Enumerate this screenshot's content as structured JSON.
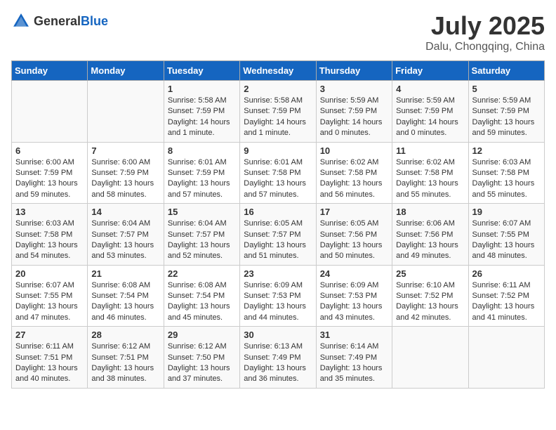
{
  "header": {
    "logo_general": "General",
    "logo_blue": "Blue",
    "month": "July 2025",
    "location": "Dalu, Chongqing, China"
  },
  "weekdays": [
    "Sunday",
    "Monday",
    "Tuesday",
    "Wednesday",
    "Thursday",
    "Friday",
    "Saturday"
  ],
  "weeks": [
    [
      {
        "day": "",
        "detail": ""
      },
      {
        "day": "",
        "detail": ""
      },
      {
        "day": "1",
        "detail": "Sunrise: 5:58 AM\nSunset: 7:59 PM\nDaylight: 14 hours\nand 1 minute."
      },
      {
        "day": "2",
        "detail": "Sunrise: 5:58 AM\nSunset: 7:59 PM\nDaylight: 14 hours\nand 1 minute."
      },
      {
        "day": "3",
        "detail": "Sunrise: 5:59 AM\nSunset: 7:59 PM\nDaylight: 14 hours\nand 0 minutes."
      },
      {
        "day": "4",
        "detail": "Sunrise: 5:59 AM\nSunset: 7:59 PM\nDaylight: 14 hours\nand 0 minutes."
      },
      {
        "day": "5",
        "detail": "Sunrise: 5:59 AM\nSunset: 7:59 PM\nDaylight: 13 hours\nand 59 minutes."
      }
    ],
    [
      {
        "day": "6",
        "detail": "Sunrise: 6:00 AM\nSunset: 7:59 PM\nDaylight: 13 hours\nand 59 minutes."
      },
      {
        "day": "7",
        "detail": "Sunrise: 6:00 AM\nSunset: 7:59 PM\nDaylight: 13 hours\nand 58 minutes."
      },
      {
        "day": "8",
        "detail": "Sunrise: 6:01 AM\nSunset: 7:59 PM\nDaylight: 13 hours\nand 57 minutes."
      },
      {
        "day": "9",
        "detail": "Sunrise: 6:01 AM\nSunset: 7:58 PM\nDaylight: 13 hours\nand 57 minutes."
      },
      {
        "day": "10",
        "detail": "Sunrise: 6:02 AM\nSunset: 7:58 PM\nDaylight: 13 hours\nand 56 minutes."
      },
      {
        "day": "11",
        "detail": "Sunrise: 6:02 AM\nSunset: 7:58 PM\nDaylight: 13 hours\nand 55 minutes."
      },
      {
        "day": "12",
        "detail": "Sunrise: 6:03 AM\nSunset: 7:58 PM\nDaylight: 13 hours\nand 55 minutes."
      }
    ],
    [
      {
        "day": "13",
        "detail": "Sunrise: 6:03 AM\nSunset: 7:58 PM\nDaylight: 13 hours\nand 54 minutes."
      },
      {
        "day": "14",
        "detail": "Sunrise: 6:04 AM\nSunset: 7:57 PM\nDaylight: 13 hours\nand 53 minutes."
      },
      {
        "day": "15",
        "detail": "Sunrise: 6:04 AM\nSunset: 7:57 PM\nDaylight: 13 hours\nand 52 minutes."
      },
      {
        "day": "16",
        "detail": "Sunrise: 6:05 AM\nSunset: 7:57 PM\nDaylight: 13 hours\nand 51 minutes."
      },
      {
        "day": "17",
        "detail": "Sunrise: 6:05 AM\nSunset: 7:56 PM\nDaylight: 13 hours\nand 50 minutes."
      },
      {
        "day": "18",
        "detail": "Sunrise: 6:06 AM\nSunset: 7:56 PM\nDaylight: 13 hours\nand 49 minutes."
      },
      {
        "day": "19",
        "detail": "Sunrise: 6:07 AM\nSunset: 7:55 PM\nDaylight: 13 hours\nand 48 minutes."
      }
    ],
    [
      {
        "day": "20",
        "detail": "Sunrise: 6:07 AM\nSunset: 7:55 PM\nDaylight: 13 hours\nand 47 minutes."
      },
      {
        "day": "21",
        "detail": "Sunrise: 6:08 AM\nSunset: 7:54 PM\nDaylight: 13 hours\nand 46 minutes."
      },
      {
        "day": "22",
        "detail": "Sunrise: 6:08 AM\nSunset: 7:54 PM\nDaylight: 13 hours\nand 45 minutes."
      },
      {
        "day": "23",
        "detail": "Sunrise: 6:09 AM\nSunset: 7:53 PM\nDaylight: 13 hours\nand 44 minutes."
      },
      {
        "day": "24",
        "detail": "Sunrise: 6:09 AM\nSunset: 7:53 PM\nDaylight: 13 hours\nand 43 minutes."
      },
      {
        "day": "25",
        "detail": "Sunrise: 6:10 AM\nSunset: 7:52 PM\nDaylight: 13 hours\nand 42 minutes."
      },
      {
        "day": "26",
        "detail": "Sunrise: 6:11 AM\nSunset: 7:52 PM\nDaylight: 13 hours\nand 41 minutes."
      }
    ],
    [
      {
        "day": "27",
        "detail": "Sunrise: 6:11 AM\nSunset: 7:51 PM\nDaylight: 13 hours\nand 40 minutes."
      },
      {
        "day": "28",
        "detail": "Sunrise: 6:12 AM\nSunset: 7:51 PM\nDaylight: 13 hours\nand 38 minutes."
      },
      {
        "day": "29",
        "detail": "Sunrise: 6:12 AM\nSunset: 7:50 PM\nDaylight: 13 hours\nand 37 minutes."
      },
      {
        "day": "30",
        "detail": "Sunrise: 6:13 AM\nSunset: 7:49 PM\nDaylight: 13 hours\nand 36 minutes."
      },
      {
        "day": "31",
        "detail": "Sunrise: 6:14 AM\nSunset: 7:49 PM\nDaylight: 13 hours\nand 35 minutes."
      },
      {
        "day": "",
        "detail": ""
      },
      {
        "day": "",
        "detail": ""
      }
    ]
  ]
}
